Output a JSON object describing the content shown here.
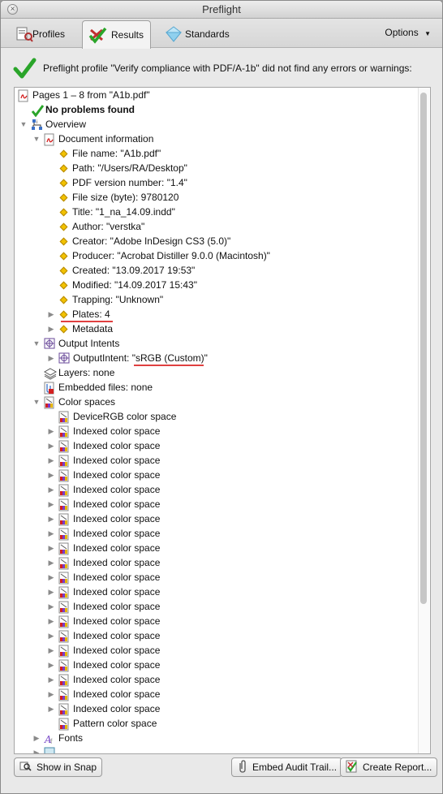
{
  "window": {
    "title": "Preflight",
    "close_label": "×"
  },
  "toolbar": {
    "tabs": [
      {
        "label": "Profiles",
        "icon": "profiles-icon"
      },
      {
        "label": "Results",
        "icon": "results-check-icon"
      },
      {
        "label": "Standards",
        "icon": "standards-diamond-icon"
      }
    ],
    "options_label": "Options",
    "options_arrow": "▼"
  },
  "status": {
    "message": "Preflight profile \"Verify compliance with PDF/A-1b\" did not find any errors or warnings:"
  },
  "tree": {
    "root": "Pages 1 – 8 from \"A1b.pdf\"",
    "no_problems": "No problems found",
    "overview": "Overview",
    "document_information": "Document information",
    "doc_info_items": [
      "File name: \"A1b.pdf\"",
      "Path: \"/Users/RA/Desktop\"",
      "PDF version number: \"1.4\"",
      "File size (byte): 9780120",
      "Title: \"1_na_14.09.indd\"",
      "Author: \"verstka\"",
      "Creator: \"Adobe InDesign CS3 (5.0)\"",
      "Producer: \"Acrobat Distiller 9.0.0 (Macintosh)\"",
      "Created: \"13.09.2017 19:53\"",
      "Modified: \"14.09.2017 15:43\"",
      "Trapping: \"Unknown\""
    ],
    "plates": "Plates: 4",
    "metadata": "Metadata",
    "output_intents": "Output Intents",
    "output_intent_prefix": "OutputIntent: ",
    "output_intent_value": "\"sRGB (Custom)\"",
    "layers": "Layers: none",
    "embedded_files": "Embedded files: none",
    "color_spaces": "Color spaces",
    "device_rgb": "DeviceRGB color space",
    "indexed_label": "Indexed color space",
    "indexed_count": 20,
    "pattern": "Pattern color space",
    "fonts": "Fonts"
  },
  "footer": {
    "show_in_snap": "Show in Snap",
    "embed_audit": "Embed Audit Trail...",
    "create_report": "Create Report..."
  },
  "colors": {
    "check_green": "#2aa52a",
    "pdf_red": "#d42020",
    "underline_red": "#e04040",
    "diamond_yellow": "#f2c200"
  }
}
